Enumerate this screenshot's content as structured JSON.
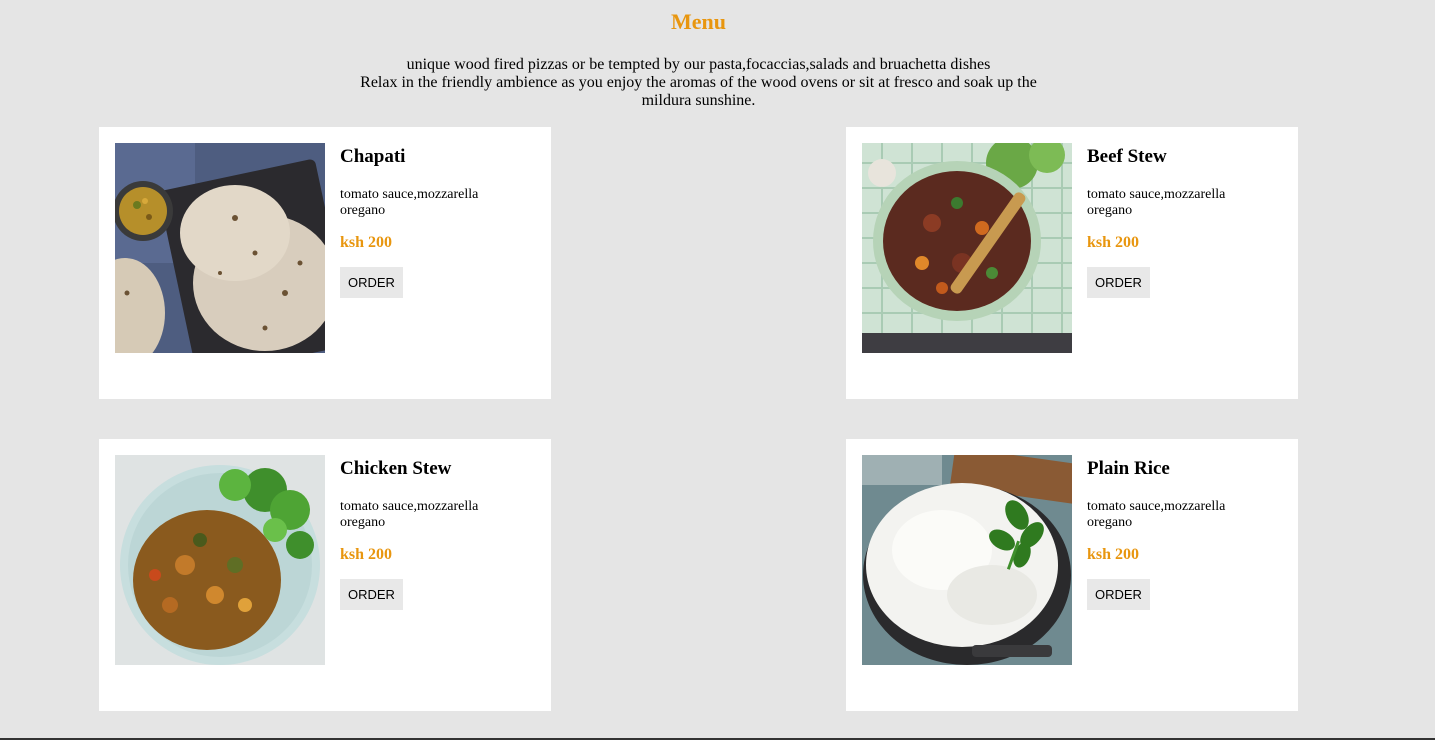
{
  "page": {
    "title": "Menu",
    "intro_line1": "unique wood fired pizzas or be tempted by our pasta,focaccias,salads and bruachetta dishes",
    "intro_line2": "Relax in the friendly ambience as you enjoy the aromas of the wood ovens or sit at fresco and soak up the mildura sunshine.",
    "accent_color": "#e8960f",
    "background_color": "#e5e5e5"
  },
  "menu": {
    "items": [
      {
        "name": "Chapati",
        "description": "tomato sauce,mozzarella oregano",
        "price": "ksh 200",
        "order_label": "ORDER",
        "image": "chapati-photo"
      },
      {
        "name": "Beef Stew",
        "description": "tomato sauce,mozzarella oregano",
        "price": "ksh 200",
        "order_label": "ORDER",
        "image": "beef-stew-photo"
      },
      {
        "name": "Chicken Stew",
        "description": "tomato sauce,mozzarella oregano",
        "price": "ksh 200",
        "order_label": "ORDER",
        "image": "chicken-stew-photo"
      },
      {
        "name": "Plain Rice",
        "description": "tomato sauce,mozzarella oregano",
        "price": "ksh 200",
        "order_label": "ORDER",
        "image": "plain-rice-photo"
      }
    ]
  }
}
